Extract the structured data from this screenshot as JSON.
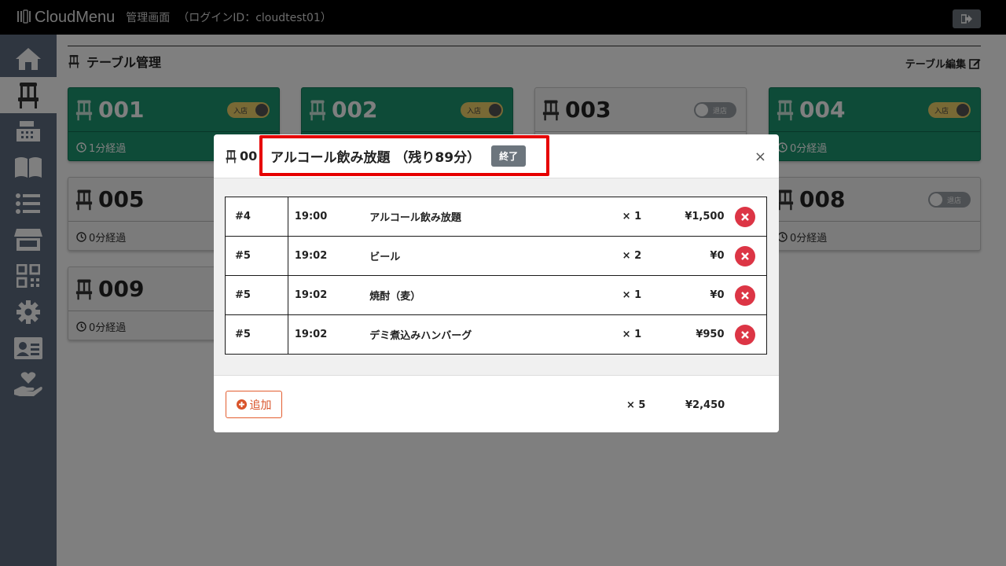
{
  "header": {
    "brand": "CloudMenu",
    "admin_label": "管理画面",
    "login_label": "（ログインID：cloudtest01）"
  },
  "sidebar": {
    "items": [
      {
        "icon": "home-icon"
      },
      {
        "icon": "chair-icon",
        "active": true
      },
      {
        "icon": "register-icon"
      },
      {
        "icon": "book-icon"
      },
      {
        "icon": "list-icon"
      },
      {
        "icon": "store-icon"
      },
      {
        "icon": "qr-code-icon"
      },
      {
        "icon": "gear-icon"
      },
      {
        "icon": "id-card-icon"
      },
      {
        "icon": "hand-heart-icon"
      }
    ]
  },
  "page": {
    "title": "テーブル管理",
    "edit_label": "テーブル編集"
  },
  "tables": [
    {
      "number": "001",
      "status": "入店",
      "elapsed": "1分経過",
      "active": true
    },
    {
      "number": "002",
      "status": "入店",
      "elapsed": "",
      "active": true
    },
    {
      "number": "003",
      "status": "退店",
      "elapsed": "",
      "active": false
    },
    {
      "number": "004",
      "status": "入店",
      "elapsed": "0分経過",
      "active": true
    },
    {
      "number": "005",
      "status": "",
      "elapsed": "0分経過",
      "active": false
    },
    {
      "number": "008",
      "status": "退店",
      "elapsed": "0分経過",
      "active": false
    },
    {
      "number": "009",
      "status": "",
      "elapsed": "0分経過",
      "active": false
    }
  ],
  "modal": {
    "table_id": "00",
    "plan_text": "アルコール飲み放題 （残り89分）",
    "end_label": "終了",
    "close_label": "×",
    "orders": [
      {
        "no": "#4",
        "time": "19:00",
        "name": "アルコール飲み放題",
        "qty": "× 1",
        "price": "¥1,500"
      },
      {
        "no": "#5",
        "time": "19:02",
        "name": "ビール",
        "qty": "× 2",
        "price": "¥0"
      },
      {
        "no": "#5",
        "time": "19:02",
        "name": "焼酎（麦）",
        "qty": "× 1",
        "price": "¥0"
      },
      {
        "no": "#5",
        "time": "19:02",
        "name": "デミ煮込みハンバーグ",
        "qty": "× 1",
        "price": "¥950"
      }
    ],
    "add_label": "追加",
    "total_qty": "× 5",
    "total_price": "¥2,450"
  },
  "colors": {
    "active_card": "#1c9670",
    "sidebar": "#5f6c80",
    "highlight": "#e60000",
    "delete": "#dc3545",
    "add": "#d9542b"
  }
}
